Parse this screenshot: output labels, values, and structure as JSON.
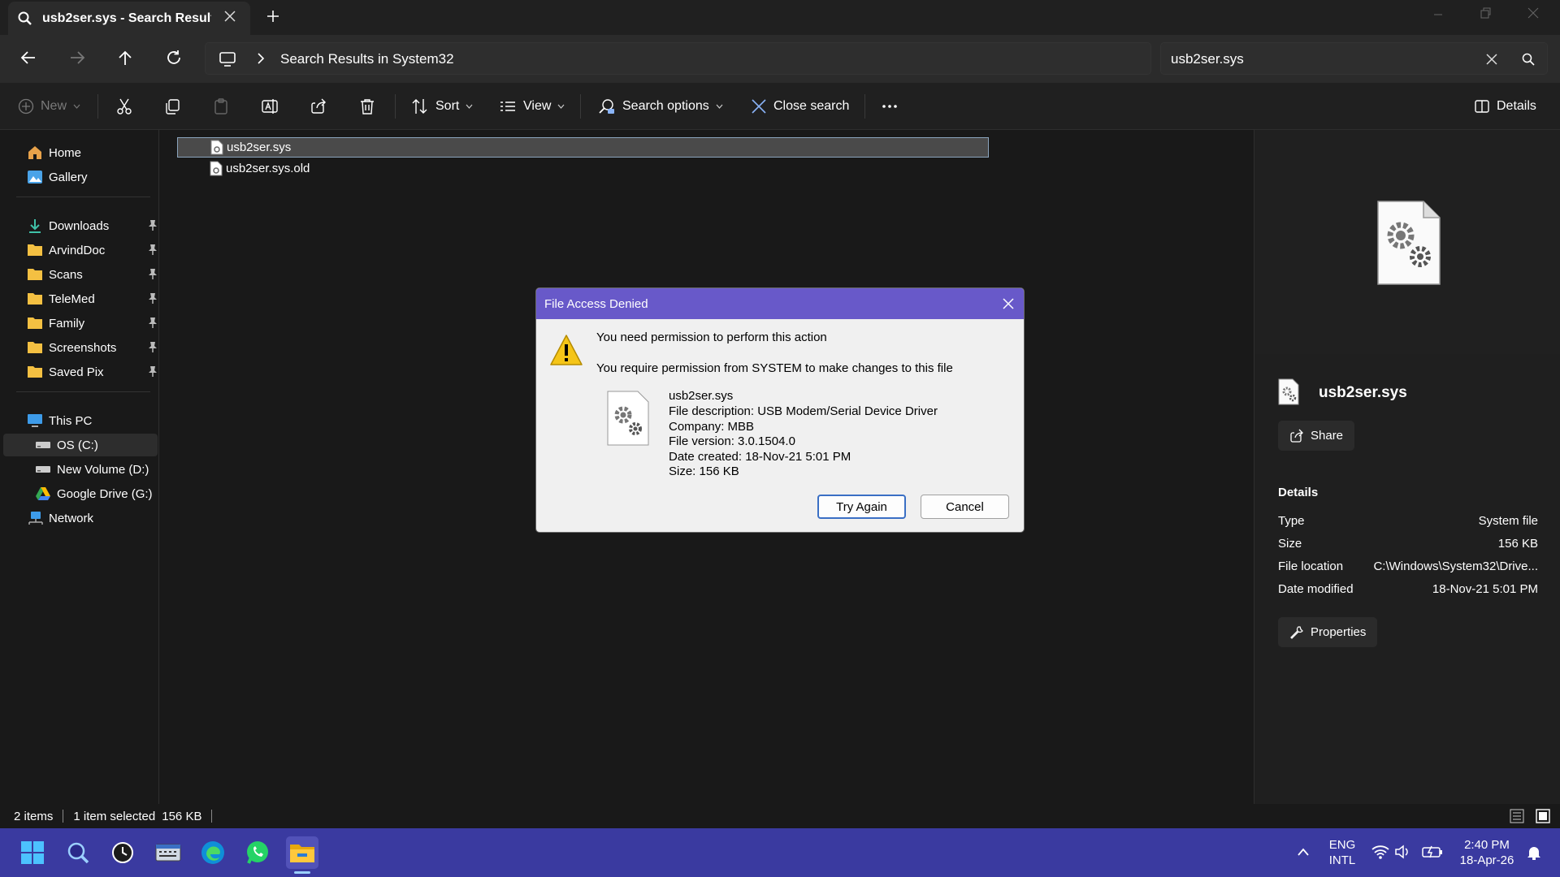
{
  "window": {
    "tab_title": "usb2ser.sys - Search Results in System32"
  },
  "address_bar": {
    "path": "Search Results in System32",
    "search_value": "usb2ser.sys"
  },
  "toolbar": {
    "new_label": "New",
    "sort_label": "Sort",
    "view_label": "View",
    "search_options_label": "Search options",
    "close_search_label": "Close search",
    "details_label": "Details"
  },
  "sidebar": {
    "items": [
      {
        "label": "Home",
        "icon": "home-icon"
      },
      {
        "label": "Gallery",
        "icon": "gallery-icon"
      },
      {
        "label": "Downloads",
        "icon": "download-icon",
        "pinned": true
      },
      {
        "label": "ArvindDoc",
        "icon": "folder-icon",
        "pinned": true
      },
      {
        "label": "Scans",
        "icon": "folder-icon",
        "pinned": true
      },
      {
        "label": "TeleMed",
        "icon": "folder-icon",
        "pinned": true
      },
      {
        "label": "Family",
        "icon": "folder-icon",
        "pinned": true
      },
      {
        "label": "Screenshots",
        "icon": "folder-icon",
        "pinned": true
      },
      {
        "label": "Saved Pix",
        "icon": "folder-icon",
        "pinned": true
      },
      {
        "label": "This PC",
        "icon": "pc-icon"
      },
      {
        "label": "OS (C:)",
        "icon": "drive-icon"
      },
      {
        "label": "New Volume (D:)",
        "icon": "drive-icon"
      },
      {
        "label": "Google Drive (G:)",
        "icon": "google-drive-icon"
      },
      {
        "label": "Network",
        "icon": "network-icon"
      }
    ]
  },
  "files": [
    {
      "name": "usb2ser.sys",
      "selected": true
    },
    {
      "name": "usb2ser.sys.old",
      "selected": false
    }
  ],
  "details_pane": {
    "file_name": "usb2ser.sys",
    "share_label": "Share",
    "section_title": "Details",
    "rows": [
      {
        "label": "Type",
        "value": "System file"
      },
      {
        "label": "Size",
        "value": "156 KB"
      },
      {
        "label": "File location",
        "value": "C:\\Windows\\System32\\Drive..."
      },
      {
        "label": "Date modified",
        "value": "18-Nov-21 5:01 PM"
      }
    ],
    "properties_label": "Properties"
  },
  "status_bar": {
    "item_count": "2 items",
    "selection": "1 item selected",
    "size": "156 KB"
  },
  "dialog": {
    "title": "File Access Denied",
    "heading": "You need permission to perform this action",
    "message": "You require permission from SYSTEM to make changes to this file",
    "file_name": "usb2ser.sys",
    "file_description": "File description: USB Modem/Serial Device Driver",
    "company": "Company: MBB",
    "file_version": "File version: 3.0.1504.0",
    "date_created": "Date created: 18-Nov-21 5:01 PM",
    "size": "Size: 156 KB",
    "try_again_label": "Try Again",
    "cancel_label": "Cancel"
  },
  "taskbar": {
    "language_line1": "ENG",
    "language_line2": "INTL",
    "time": "2:40 PM",
    "date": "18-Apr-26"
  },
  "colors": {
    "dialog_title_bar": "#6859c9",
    "taskbar": "#3a3aa0",
    "selection_border": "#8ba4bd"
  }
}
